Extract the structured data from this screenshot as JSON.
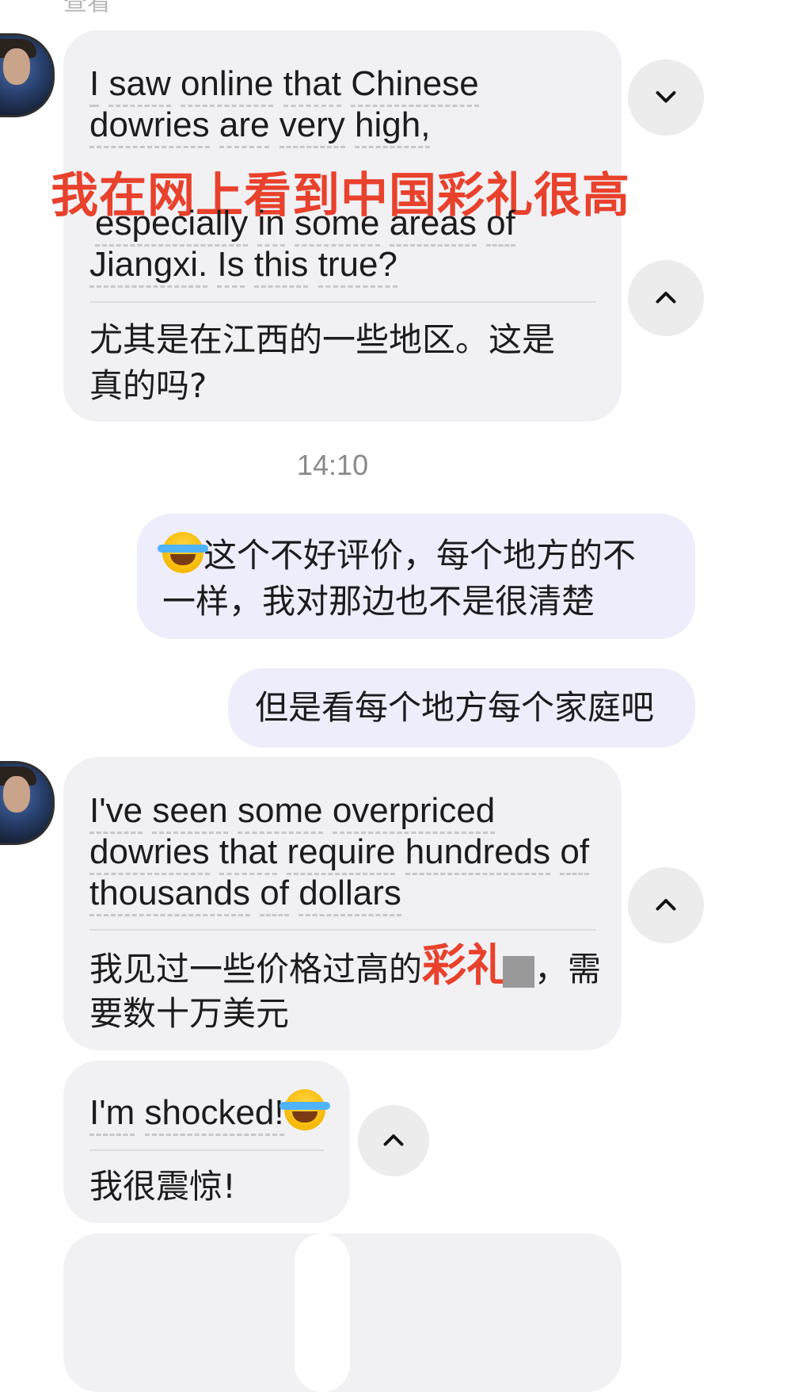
{
  "top_fragment": "查看",
  "messages": {
    "m1": {
      "en_line1": [
        "I",
        "saw",
        "online",
        "that",
        "Chinese"
      ],
      "en_line2": [
        "dowries",
        "are",
        "very",
        "high,"
      ],
      "overlay": "我在网上看到中国彩礼很高",
      "en_line3": [
        "especially",
        "in",
        "some",
        "areas",
        "of"
      ],
      "en_line4": [
        "Jiangxi.",
        "Is",
        "this",
        "true?"
      ],
      "zh_line1": "尤其是在江西的一些地区。这是",
      "zh_line2": "真的吗?"
    },
    "timestamp": "14:10",
    "m2": {
      "line1": "这个不好评价，每个地方的不",
      "line2": "一样，我对那边也不是很清楚"
    },
    "m3": {
      "text": "但是看每个地方每个家庭吧"
    },
    "m4": {
      "en_line1": [
        "I've",
        "seen",
        "some",
        "overpriced"
      ],
      "en_line2": [
        "dowries",
        "that",
        "require",
        "hundreds",
        "of"
      ],
      "en_line3": [
        "thousands",
        "of",
        "dollars"
      ],
      "zh_line1_a": "我见过一些价格过高的",
      "zh_line1_red": "彩礼",
      "zh_line1_b": "，需",
      "zh_line2": "要数十万美元"
    },
    "m5": {
      "en": [
        "I'm",
        "shocked!"
      ],
      "zh": "我很震惊!"
    }
  },
  "icons": {
    "collapse": "chevron-down-icon",
    "expand": "chevron-up-icon",
    "emoji": "tears-of-joy-emoji"
  }
}
